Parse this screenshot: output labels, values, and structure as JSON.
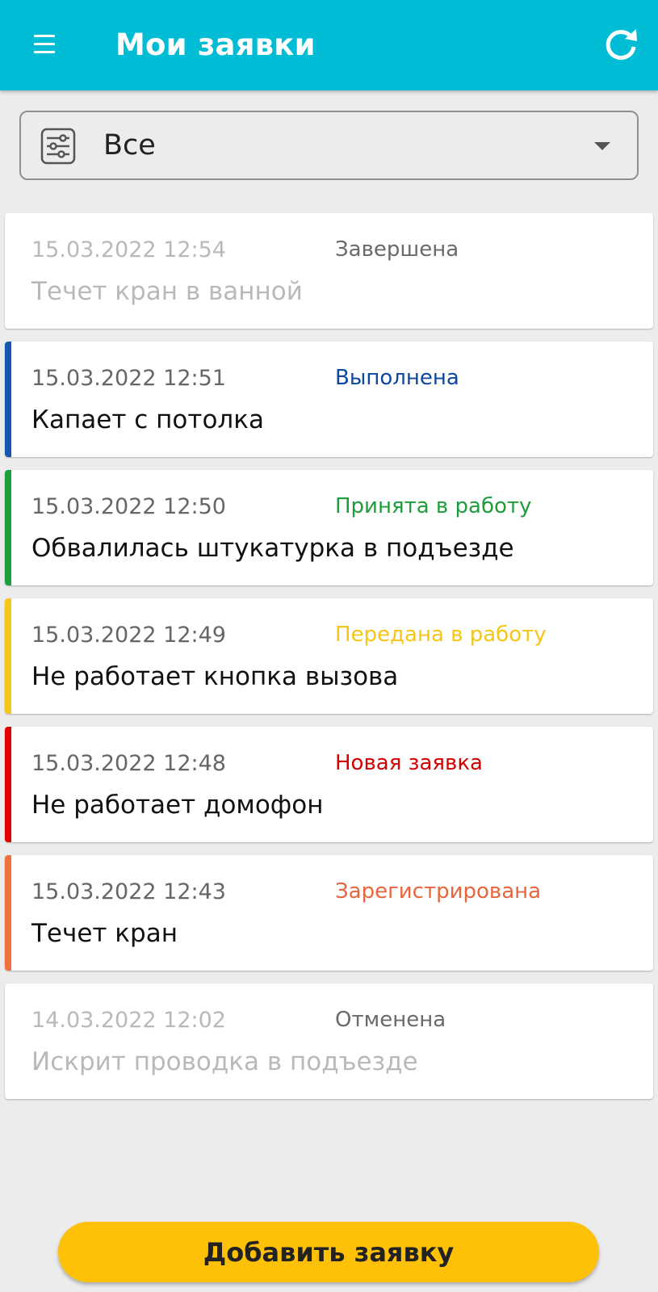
{
  "app_bar": {
    "title": "Мои заявки",
    "menu_icon": "hamburger-icon",
    "refresh_icon": "refresh-icon",
    "background": "#00bcd4"
  },
  "filter": {
    "value": "Все",
    "icon": "filter-sliders-icon",
    "caret_icon": "dropdown-caret-icon"
  },
  "requests": [
    {
      "date": "15.03.2022 12:54",
      "status": "Завершена",
      "description": "Течет кран в ванной",
      "status_color": "#6a6a6a",
      "accent_color": "",
      "dimmed": true
    },
    {
      "date": "15.03.2022 12:51",
      "status": "Выполнена",
      "description": "Капает с потолка",
      "status_color": "#0d47a1",
      "accent_color": "#1557b0",
      "dimmed": false
    },
    {
      "date": "15.03.2022 12:50",
      "status": "Принята в работу",
      "description": "Обвалилась штукатурка в подъезде",
      "status_color": "#1e9e3a",
      "accent_color": "#1e9e3a",
      "dimmed": false
    },
    {
      "date": "15.03.2022 12:49",
      "status": "Передана в работу",
      "description": "Не работает кнопка вызова",
      "status_color": "#f5c518",
      "accent_color": "#f5c518",
      "dimmed": false
    },
    {
      "date": "15.03.2022 12:48",
      "status": "Новая заявка",
      "description": "Не работает домофон",
      "status_color": "#d50000",
      "accent_color": "#e00000",
      "dimmed": false
    },
    {
      "date": "15.03.2022 12:43",
      "status": "Зарегистрирована",
      "description": "Течет кран",
      "status_color": "#e8663d",
      "accent_color": "#f0703f",
      "dimmed": false
    },
    {
      "date": "14.03.2022 12:02",
      "status": "Отменена",
      "description": "Искрит проводка в подъезде",
      "status_color": "#6a6a6a",
      "accent_color": "",
      "dimmed": true
    }
  ],
  "add_button": {
    "label": "Добавить заявку",
    "color": "#ffc107"
  }
}
